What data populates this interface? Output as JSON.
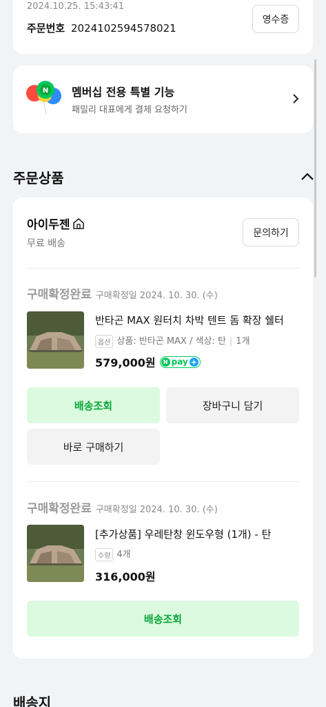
{
  "order": {
    "datetime": "2024.10.25. 15:43:41",
    "number_label": "주문번호",
    "number": "2024102594578021",
    "receipt_button": "영수증"
  },
  "membership": {
    "title": "멤버십 전용 특별 기능",
    "subtitle": "패밀리 대표에게 결제 요청하기"
  },
  "products_section": {
    "title": "주문상품"
  },
  "seller": {
    "name": "아이두젠",
    "shipping": "무료 배송",
    "inquiry_button": "문의하기"
  },
  "items": [
    {
      "status": "구매확정완료",
      "status_date": "구매확정일 2024. 10. 30. (수)",
      "name": "반타곤 MAX 원터치 차박 텐트 돔 확장 쉘터",
      "option_tag": "옵션",
      "option_text": "상품: 반타곤 MAX / 색상: 탄",
      "qty": "1개",
      "price": "579,000원",
      "pay_badge": "pay",
      "buttons": {
        "track": "배송조회",
        "cart": "장바구니 담기",
        "buy": "바로 구매하기"
      }
    },
    {
      "status": "구매확정완료",
      "status_date": "구매확정일 2024. 10. 30. (수)",
      "name": "[추가상품] 우레탄창 윈도우형 (1개) - 탄",
      "option_tag": "수량",
      "option_text": "4개",
      "price": "316,000원",
      "buttons": {
        "track": "배송조회"
      }
    }
  ],
  "shipping_section": {
    "title": "배송지"
  },
  "colors": {
    "green": "#0aa73a",
    "green_bg": "#dcfadf",
    "npay_green": "#03c75a"
  }
}
